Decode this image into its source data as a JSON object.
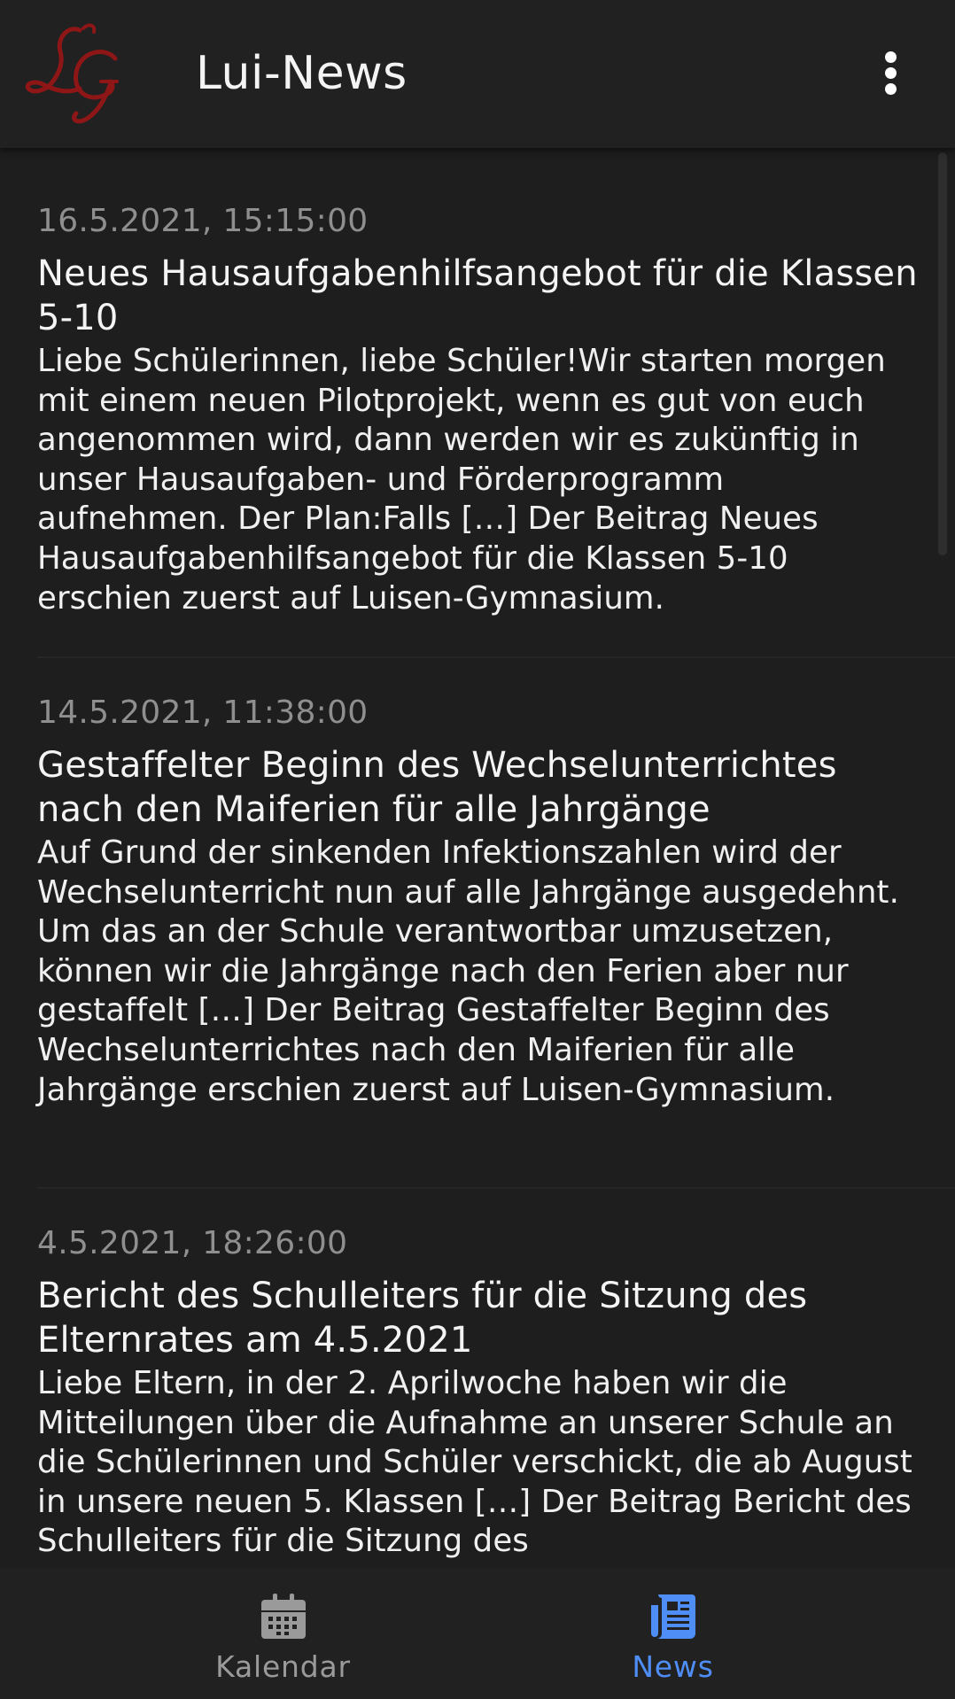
{
  "app": {
    "title": "Lui-News",
    "logo_icon": "lg-monogram-logo",
    "menu_icon": "more-vertical-icon"
  },
  "colors": {
    "background": "#1e1e1e",
    "appbar": "#212121",
    "date_text": "#8f8f8f",
    "inactive_nav": "#9a9a9a",
    "active_nav": "#4f8ef7",
    "logo_red": "#8e1616"
  },
  "news": [
    {
      "date": "16.5.2021, 15:15:00",
      "title": "Neues Hausaufgabenhilfsangebot für die Klassen 5-10",
      "excerpt": "Liebe Schülerinnen, liebe Schüler!Wir starten morgen mit einem neuen Pilotprojekt, wenn es gut von euch angenommen wird, dann werden wir es zukünftig in unser Hausaufgaben- und Förderprogramm aufnehmen. Der Plan:Falls […] Der Beitrag Neues Hausaufgabenhilfsangebot für die Klassen 5-10 erschien zuerst auf Luisen-Gymnasium."
    },
    {
      "date": "14.5.2021, 11:38:00",
      "title": "Gestaffelter Beginn des Wechselunterrichtes nach den Maiferien für alle Jahrgänge",
      "excerpt": "Auf Grund der sinkenden Infektionszahlen wird der Wechselunterricht nun auf alle Jahrgänge ausgedehnt. Um das an der Schule verantwortbar umzusetzen, können wir die Jahrgänge nach den Ferien aber nur gestaffelt […] Der Beitrag Gestaffelter Beginn des Wechselunterrichtes nach den Maiferien für alle Jahrgänge erschien zuerst auf Luisen-Gymnasium."
    },
    {
      "date": "4.5.2021, 18:26:00",
      "title": "Bericht des Schulleiters für die Sitzung des Elternrates am 4.5.2021",
      "excerpt": "Liebe Eltern,  in der 2. Aprilwoche haben wir die Mitteilungen über die Aufnahme an unserer Schule an die Schülerinnen und Schüler verschickt, die ab August in unsere neuen 5. Klassen […] Der Beitrag Bericht des Schulleiters für die Sitzung des"
    }
  ],
  "bottom_nav": [
    {
      "label": "Kalendar",
      "icon": "calendar-icon",
      "active": false
    },
    {
      "label": "News",
      "icon": "newspaper-icon",
      "active": true
    }
  ]
}
